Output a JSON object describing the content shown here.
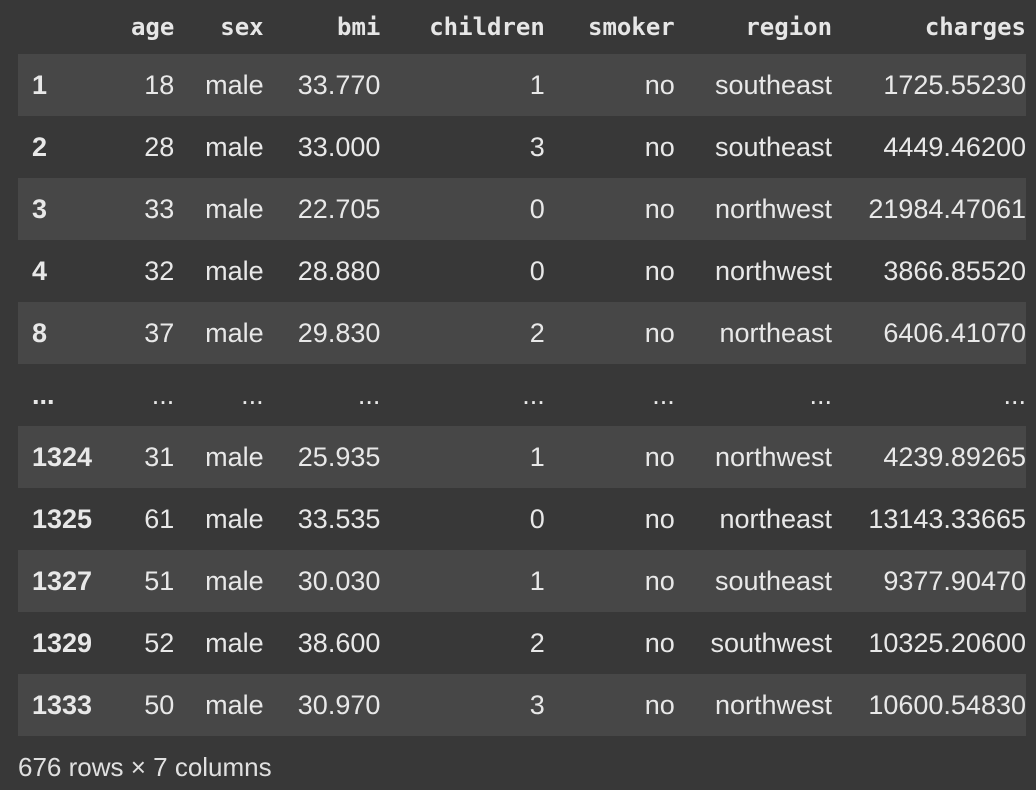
{
  "table": {
    "columns": [
      "",
      "age",
      "sex",
      "bmi",
      "children",
      "smoker",
      "region",
      "charges"
    ],
    "rows": [
      {
        "index": "1",
        "cells": [
          "18",
          "male",
          "33.770",
          "1",
          "no",
          "southeast",
          "1725.55230"
        ]
      },
      {
        "index": "2",
        "cells": [
          "28",
          "male",
          "33.000",
          "3",
          "no",
          "southeast",
          "4449.46200"
        ]
      },
      {
        "index": "3",
        "cells": [
          "33",
          "male",
          "22.705",
          "0",
          "no",
          "northwest",
          "21984.47061"
        ]
      },
      {
        "index": "4",
        "cells": [
          "32",
          "male",
          "28.880",
          "0",
          "no",
          "northwest",
          "3866.85520"
        ]
      },
      {
        "index": "8",
        "cells": [
          "37",
          "male",
          "29.830",
          "2",
          "no",
          "northeast",
          "6406.41070"
        ]
      },
      {
        "index": "...",
        "cells": [
          "...",
          "...",
          "...",
          "...",
          "...",
          "...",
          "..."
        ]
      },
      {
        "index": "1324",
        "cells": [
          "31",
          "male",
          "25.935",
          "1",
          "no",
          "northwest",
          "4239.89265"
        ]
      },
      {
        "index": "1325",
        "cells": [
          "61",
          "male",
          "33.535",
          "0",
          "no",
          "northeast",
          "13143.33665"
        ]
      },
      {
        "index": "1327",
        "cells": [
          "51",
          "male",
          "30.030",
          "1",
          "no",
          "southeast",
          "9377.90470"
        ]
      },
      {
        "index": "1329",
        "cells": [
          "52",
          "male",
          "38.600",
          "2",
          "no",
          "southwest",
          "10325.20600"
        ]
      },
      {
        "index": "1333",
        "cells": [
          "50",
          "male",
          "30.970",
          "3",
          "no",
          "northwest",
          "10600.54830"
        ]
      }
    ]
  },
  "footer": {
    "shape_text": "676 rows × 7 columns"
  },
  "colors": {
    "background": "#383838",
    "row_stripe": "#474747",
    "text": "#e8e8e8"
  }
}
